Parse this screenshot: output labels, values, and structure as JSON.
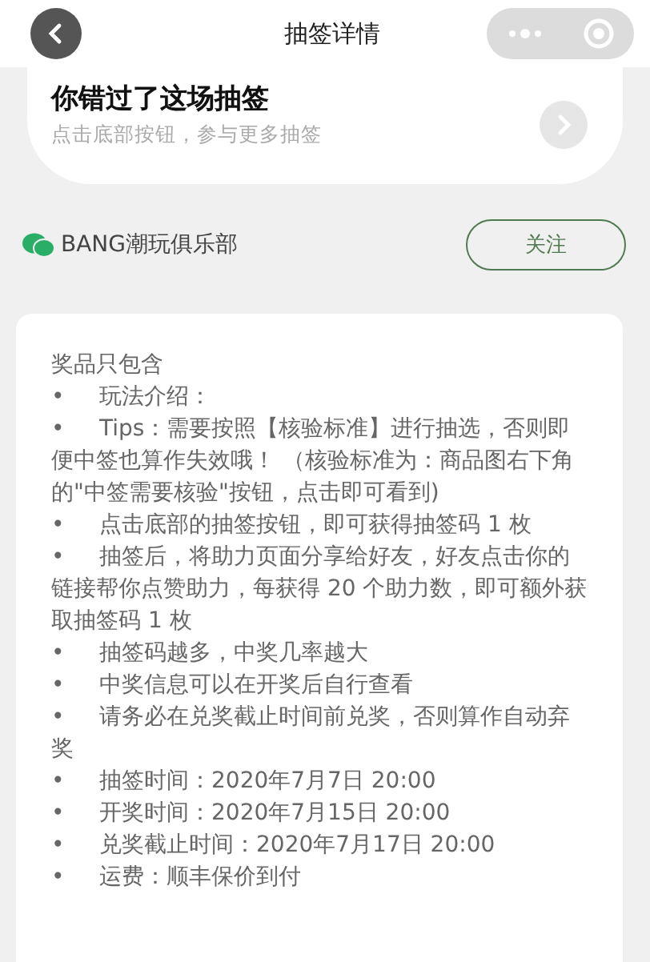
{
  "nav": {
    "title": "抽签详情"
  },
  "status_card": {
    "title": "你错过了这场抽签",
    "subtitle": "点击底部按钮，参与更多抽签"
  },
  "club": {
    "name": "BANG潮玩俱乐部",
    "follow_button": "关注"
  },
  "rules": {
    "heading": "奖品只包含",
    "items": [
      {
        "bullet": "•",
        "text": "玩法介绍："
      },
      {
        "bullet": "•",
        "text": "Tips：需要按照【核验标准】进行抽选，否则即便中签也算作失效哦！ （核验标准为：商品图右下角的\"中签需要核验\"按钮，点击即可看到)"
      },
      {
        "bullet": "•",
        "text": "点击底部的抽签按钮，即可获得抽签码 1 枚"
      },
      {
        "bullet": "•",
        "text": "抽签后，将助力页面分享给好友，好友点击你的链接帮你点赞助力，每获得 20 个助力数，即可额外获取抽签码 1 枚"
      },
      {
        "bullet": "•",
        "text": "抽签码越多，中奖几率越大"
      },
      {
        "bullet": "•",
        "text": "中奖信息可以在开奖后自行查看"
      },
      {
        "bullet": "•",
        "text": "请务必在兑奖截止时间前兑奖，否则算作自动弃奖"
      },
      {
        "bullet": "•",
        "text": "抽签时间：2020年7月7日 20:00"
      },
      {
        "bullet": "•",
        "text": "开奖时间：2020年7月15日 20:00"
      },
      {
        "bullet": "•",
        "text": "兑奖截止时间：2020年7月17日 20:00"
      },
      {
        "bullet": "•",
        "text": "运费：顺丰保价到付"
      }
    ]
  }
}
